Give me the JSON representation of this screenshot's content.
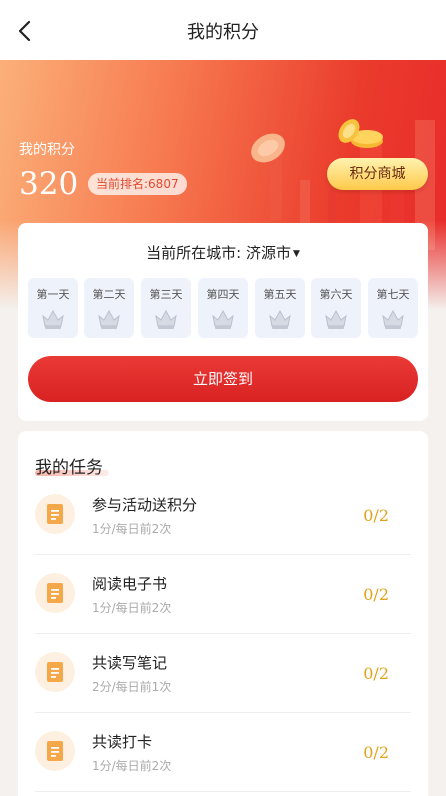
{
  "navbar": {
    "title": "我的积分",
    "back_icon": "chevron-left-icon"
  },
  "points": {
    "label": "我的积分",
    "value": "320",
    "rank_text": "当前排名:6807",
    "mall_button": "积分商城"
  },
  "signin": {
    "city_prefix": "当前所在城市:",
    "city": "济源市",
    "days": [
      {
        "label": "第一天",
        "icon": "crown-icon"
      },
      {
        "label": "第二天",
        "icon": "crown-icon"
      },
      {
        "label": "第三天",
        "icon": "crown-icon"
      },
      {
        "label": "第四天",
        "icon": "crown-icon"
      },
      {
        "label": "第五天",
        "icon": "crown-icon"
      },
      {
        "label": "第六天",
        "icon": "crown-icon"
      },
      {
        "label": "第七天",
        "icon": "crown-icon"
      }
    ],
    "button": "立即签到"
  },
  "tasks": {
    "title": "我的任务",
    "items": [
      {
        "name": "参与活动送积分",
        "desc": "1分/每日前2次",
        "progress": "0/2",
        "icon": "document-icon"
      },
      {
        "name": "阅读电子书",
        "desc": "1分/每日前2次",
        "progress": "0/2",
        "icon": "document-icon"
      },
      {
        "name": "共读写笔记",
        "desc": "2分/每日前1次",
        "progress": "0/2",
        "icon": "document-icon"
      },
      {
        "name": "共读打卡",
        "desc": "1分/每日前2次",
        "progress": "0/2",
        "icon": "document-icon"
      }
    ]
  },
  "colors": {
    "accent_red": "#d82222",
    "gold": "#e0a21a",
    "hero_start": "#fbb07a",
    "hero_end": "#e82a2a"
  }
}
